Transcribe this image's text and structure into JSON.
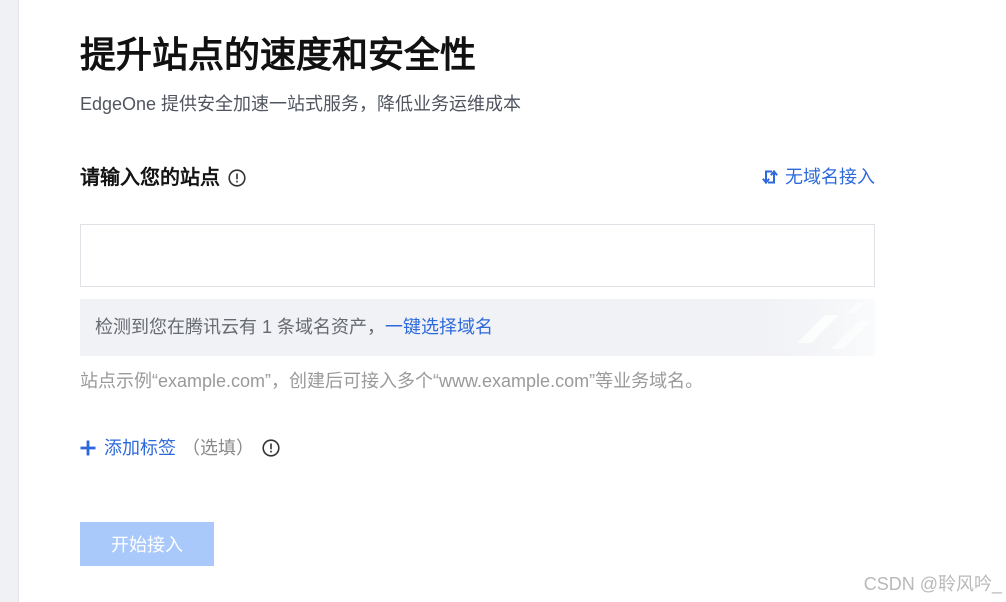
{
  "page": {
    "title": "提升站点的速度和安全性",
    "subtitle": "EdgeOne 提供安全加速一站式服务，降低业务运维成本"
  },
  "site_input": {
    "label": "请输入您的站点",
    "label_icon": "info-circle-icon",
    "value": "",
    "no_domain_icon": "swap-icon",
    "no_domain_link": "无域名接入"
  },
  "asset_hint": {
    "text": "检测到您在腾讯云有 1 条域名资产，",
    "link": "一键选择域名"
  },
  "helper_text": "站点示例“example.com”，创建后可接入多个“www.example.com”等业务域名。",
  "tags": {
    "plus_icon": "plus-icon",
    "add_label": "添加标签",
    "optional": "（选填）",
    "info_icon": "info-circle-icon"
  },
  "submit": {
    "label": "开始接入",
    "disabled": true
  },
  "watermark": "CSDN @聆风吟_",
  "colors": {
    "link": "#2e69db",
    "button_disabled": "#a9c9fb",
    "hint_background": "#f1f2f5",
    "input_border": "#dfe1e6"
  }
}
